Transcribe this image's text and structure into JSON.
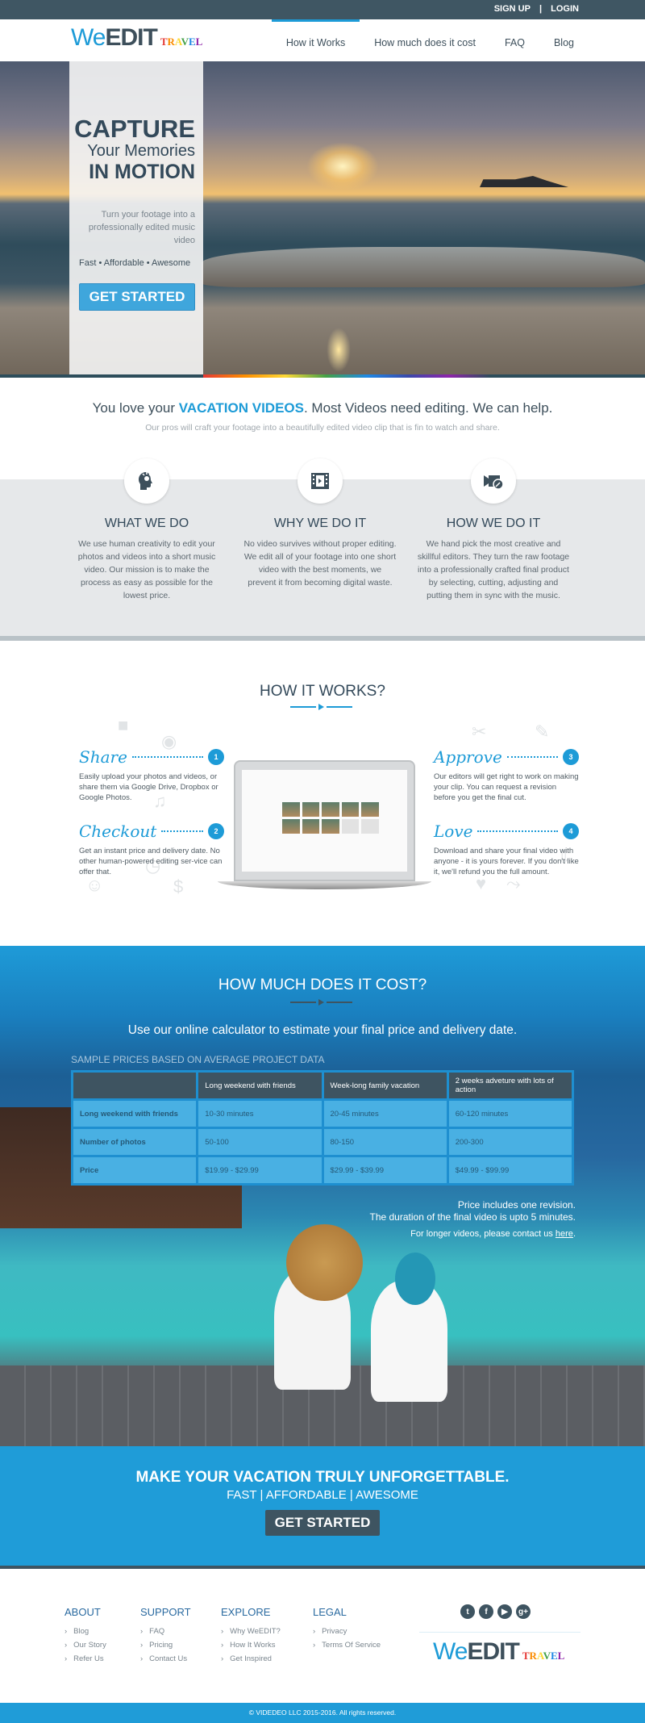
{
  "topbar": {
    "signup": "SIGN UP",
    "separator": "|",
    "login": "LOGIN"
  },
  "logo": {
    "we": "We",
    "edit": "EDIT",
    "travel": [
      "T",
      "R",
      "A",
      "V",
      "E",
      "L"
    ]
  },
  "nav": [
    {
      "label": "How it Works",
      "active": true
    },
    {
      "label": "How much does it cost",
      "active": false
    },
    {
      "label": "FAQ",
      "active": false
    },
    {
      "label": "Blog",
      "active": false
    }
  ],
  "hero": {
    "line1": "CAPTURE",
    "line2": "Your Memories",
    "line3": "IN MOTION",
    "sub": "Turn your footage into a professionally edited music video",
    "tagline": "Fast • Affordable • Awesome",
    "cta": "GET STARTED"
  },
  "intro": {
    "lead_pre": "You love your ",
    "lead_highlight": "VACATION VIDEOS",
    "lead_post": ". Most Videos need editing. We can help.",
    "sub": "Our pros will craft your footage into a beautifully edited video clip that is fin to watch and share."
  },
  "features": [
    {
      "icon": "lightbulb-head-icon",
      "title": "WHAT WE DO",
      "text": "We use human creativity to edit your photos and videos into a short music video. Our mission is to make the process as easy as possible for the lowest price."
    },
    {
      "icon": "film-play-icon",
      "title": "WHY WE DO IT",
      "text": "No video survives without proper editing. We edit all of your footage into one short video with the best moments, we prevent it from becoming digital waste."
    },
    {
      "icon": "video-camera-edit-icon",
      "title": "HOW WE DO IT",
      "text": "We hand pick the most creative and skillful editors. They turn the raw footage into a professionally crafted final product by selecting, cutting, adjusting and putting them in sync with the music."
    }
  ],
  "how_it_works": {
    "title": "HOW IT WORKS?",
    "steps": [
      {
        "name": "Share",
        "num": "1",
        "desc": "Easily upload your photos and videos, or share them via Google Drive, Dropbox or Google Photos."
      },
      {
        "name": "Checkout",
        "num": "2",
        "desc": "Get an instant price and delivery date. No other human-powered editing ser-vice can offer that."
      },
      {
        "name": "Approve",
        "num": "3",
        "desc": "Our editors will get right to work on making your clip. You can request a revision before you get the final cut."
      },
      {
        "name": "Love",
        "num": "4",
        "desc": "Download and share your final video with anyone - it is yours forever. If you don't like it, we'll refund you the full amount."
      }
    ]
  },
  "pricing": {
    "title": "HOW MUCH DOES IT COST?",
    "lead": "Use our online calculator to estimate your final price and delivery date.",
    "sample_label": "SAMPLE PRICES BASED ON AVERAGE PROJECT DATA",
    "columns": [
      "",
      "Long weekend with friends",
      "Week-long family vacation",
      "2 weeks adveture with lots of action"
    ],
    "rows": [
      [
        "Long weekend with friends",
        "10-30 minutes",
        "20-45 minutes",
        "60-120 minutes"
      ],
      [
        "Number of photos",
        "50-100",
        "80-150",
        "200-300"
      ],
      [
        "Price",
        "$19.99 - $29.99",
        "$29.99 - $39.99",
        "$49.99 - $99.99"
      ]
    ],
    "note1": "Price includes one revision.",
    "note2": "The duration of the final video is upto 5 minutes.",
    "note3_pre": "For longer videos, please contact us ",
    "note3_link": "here",
    "note3_post": "."
  },
  "cta_band": {
    "headline": "MAKE YOUR VACATION TRULY UNFORGETTABLE.",
    "sub": "FAST | AFFORDABLE | AWESOME",
    "button": "GET STARTED"
  },
  "footer": {
    "columns": [
      {
        "heading": "ABOUT",
        "links": [
          "Blog",
          "Our Story",
          "Refer Us"
        ]
      },
      {
        "heading": "SUPPORT",
        "links": [
          "FAQ",
          "Pricing",
          "Contact Us"
        ]
      },
      {
        "heading": "EXPLORE",
        "links": [
          "Why WeEDIT?",
          "How It Works",
          "Get Inspired"
        ]
      },
      {
        "heading": "LEGAL",
        "links": [
          "Privacy",
          "Terms Of Service"
        ]
      }
    ],
    "social": [
      {
        "icon": "twitter-icon",
        "glyph": "t"
      },
      {
        "icon": "facebook-icon",
        "glyph": "f"
      },
      {
        "icon": "youtube-icon",
        "glyph": "▶"
      },
      {
        "icon": "google-plus-icon",
        "glyph": "g+"
      }
    ],
    "copyright": "© VIDEDEO LLC 2015-2016. All rights reserved."
  },
  "colors": {
    "accent": "#1d9bd7",
    "dark": "#3e5461",
    "table_cell": "#49b0e3"
  }
}
